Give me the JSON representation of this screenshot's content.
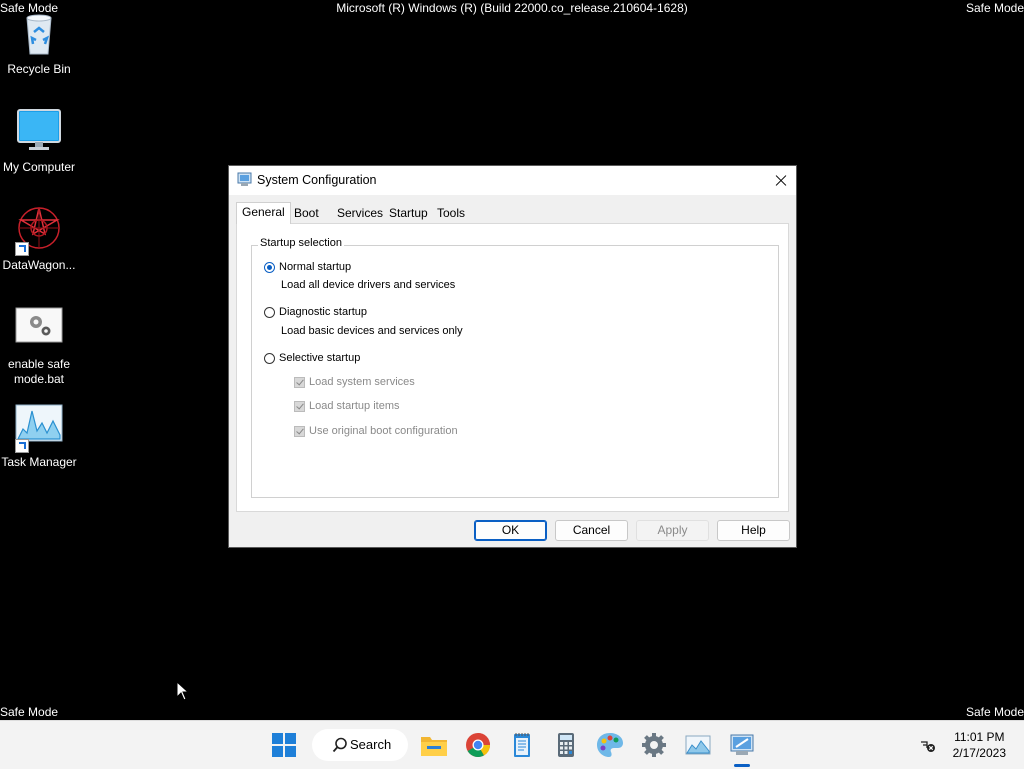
{
  "watermarks": {
    "top_left": "Safe Mode",
    "top_right": "Safe Mode",
    "bottom_left": "Safe Mode",
    "bottom_right": "Safe Mode",
    "build": "Microsoft (R) Windows (R) (Build 22000.co_release.210604-1628)"
  },
  "desktop": {
    "icons": [
      {
        "label": "Recycle Bin",
        "icon": "recycle-bin-icon"
      },
      {
        "label": "My Computer",
        "icon": "computer-icon"
      },
      {
        "label": "DataWagon...",
        "icon": "datawagon-icon"
      },
      {
        "label": "enable safe mode.bat",
        "icon": "batch-file-icon"
      },
      {
        "label": "Task Manager",
        "icon": "task-manager-icon"
      }
    ]
  },
  "dialog": {
    "title": "System Configuration",
    "tabs": [
      {
        "label": "General",
        "active": true
      },
      {
        "label": "Boot"
      },
      {
        "label": "Services"
      },
      {
        "label": "Startup"
      },
      {
        "label": "Tools"
      }
    ],
    "group_label": "Startup selection",
    "options": {
      "normal": {
        "label": "Normal startup",
        "desc": "Load all device drivers and services",
        "checked": true
      },
      "diagnostic": {
        "label": "Diagnostic startup",
        "desc": "Load basic devices and services only",
        "checked": false
      },
      "selective": {
        "label": "Selective startup",
        "checked": false
      }
    },
    "selective_items": [
      {
        "label": "Load system services",
        "checked": true,
        "disabled": true
      },
      {
        "label": "Load startup items",
        "checked": true,
        "disabled": true
      },
      {
        "label": "Use original boot configuration",
        "checked": true,
        "disabled": true
      }
    ],
    "buttons": {
      "ok": "OK",
      "cancel": "Cancel",
      "apply": "Apply",
      "help": "Help"
    }
  },
  "taskbar": {
    "search_label": "Search",
    "time": "11:01 PM",
    "date": "2/17/2023",
    "accent": "#0a5fc4"
  }
}
